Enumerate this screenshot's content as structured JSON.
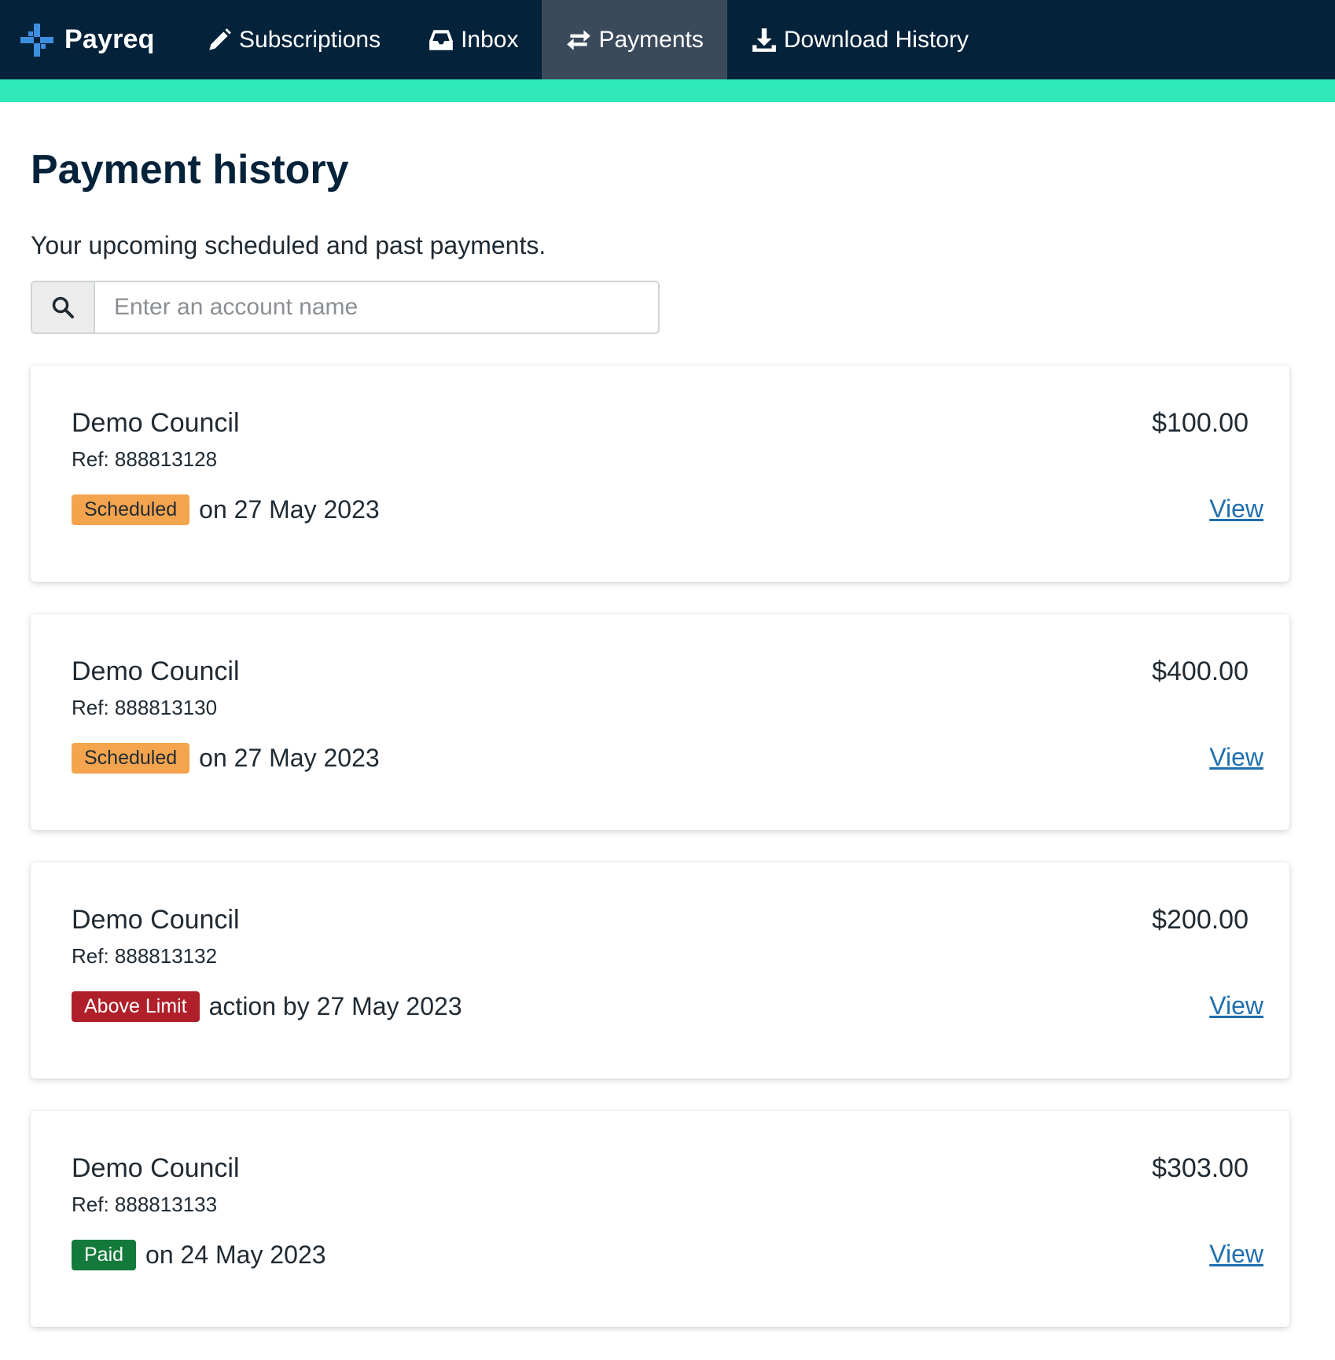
{
  "app": {
    "name": "Payreq"
  },
  "nav": {
    "subscriptions": "Subscriptions",
    "inbox": "Inbox",
    "payments": "Payments",
    "download_history": "Download History"
  },
  "page": {
    "title": "Payment history",
    "subtitle": "Your upcoming scheduled and past payments."
  },
  "search": {
    "placeholder": "Enter an account name",
    "value": ""
  },
  "payments": [
    {
      "account": "Demo Council",
      "ref": "Ref: 888813128",
      "status": "Scheduled",
      "status_text": "on 27 May 2023",
      "amount": "$100.00",
      "action": "View"
    },
    {
      "account": "Demo Council",
      "ref": "Ref: 888813130",
      "status": "Scheduled",
      "status_text": "on 27 May 2023",
      "amount": "$400.00",
      "action": "View"
    },
    {
      "account": "Demo Council",
      "ref": "Ref: 888813132",
      "status": "Above Limit",
      "status_text": "action by 27 May 2023",
      "amount": "$200.00",
      "action": "View"
    },
    {
      "account": "Demo Council",
      "ref": "Ref: 888813133",
      "status": "Paid",
      "status_text": "on 24 May 2023",
      "amount": "$303.00",
      "action": "View"
    }
  ],
  "colors": {
    "topbar": "#04233a",
    "accent": "#2ee8b8",
    "active_nav": "#3b4a5b",
    "scheduled": "#f4a44d",
    "above_limit": "#b0202a",
    "paid": "#147a3c",
    "link": "#1f6fb0"
  },
  "icons": {
    "logo": "payreq-logo-icon",
    "subscriptions": "pencil-icon",
    "inbox": "inbox-icon",
    "payments": "exchange-arrows-icon",
    "download_history": "download-icon",
    "search": "search-icon"
  }
}
